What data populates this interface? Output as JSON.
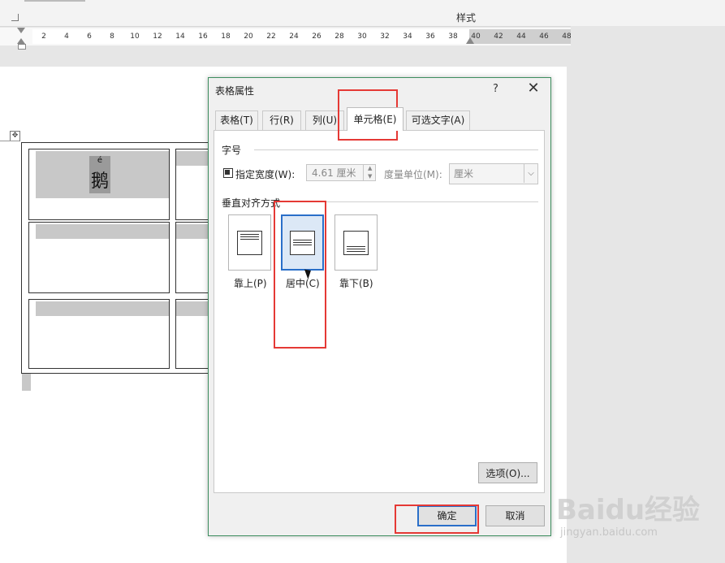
{
  "ribbon": {
    "styles_label": "样式"
  },
  "ruler": {
    "ticks": [
      "2",
      "4",
      "6",
      "8",
      "10",
      "12",
      "14",
      "16",
      "18",
      "20",
      "22",
      "24",
      "26",
      "28",
      "30",
      "32",
      "34",
      "36",
      "38",
      "40",
      "42",
      "44",
      "46",
      "48"
    ]
  },
  "document": {
    "ruby_pinyin": "é",
    "ruby_char": "鹅",
    "table_handle_icon": "move-icon"
  },
  "dialog": {
    "title": "表格属性",
    "help": "?",
    "close": "✕",
    "tabs": [
      {
        "label": "表格(T)"
      },
      {
        "label": "行(R)"
      },
      {
        "label": "列(U)"
      },
      {
        "label": "单元格(E)",
        "active": true
      },
      {
        "label": "可选文字(A)"
      }
    ],
    "size_group": "字号",
    "preferred_width_label": "指定宽度(W):",
    "preferred_width_checked": true,
    "width_value": "4.61 厘米",
    "measure_in_label": "度量单位(M):",
    "measure_in_value": "厘米",
    "valign_group": "垂直对齐方式",
    "valign_options": [
      {
        "label": "靠上(P)"
      },
      {
        "label": "居中(C)",
        "selected": true
      },
      {
        "label": "靠下(B)"
      }
    ],
    "options_button": "选项(O)...",
    "ok_button": "确定",
    "cancel_button": "取消"
  },
  "watermark": {
    "brand": "Baidu经验",
    "url": "jingyan.baidu.com"
  },
  "colors": {
    "highlight_red": "#e53935",
    "accent_blue": "#2a6fc9",
    "dialog_border": "#3c8d5e"
  }
}
